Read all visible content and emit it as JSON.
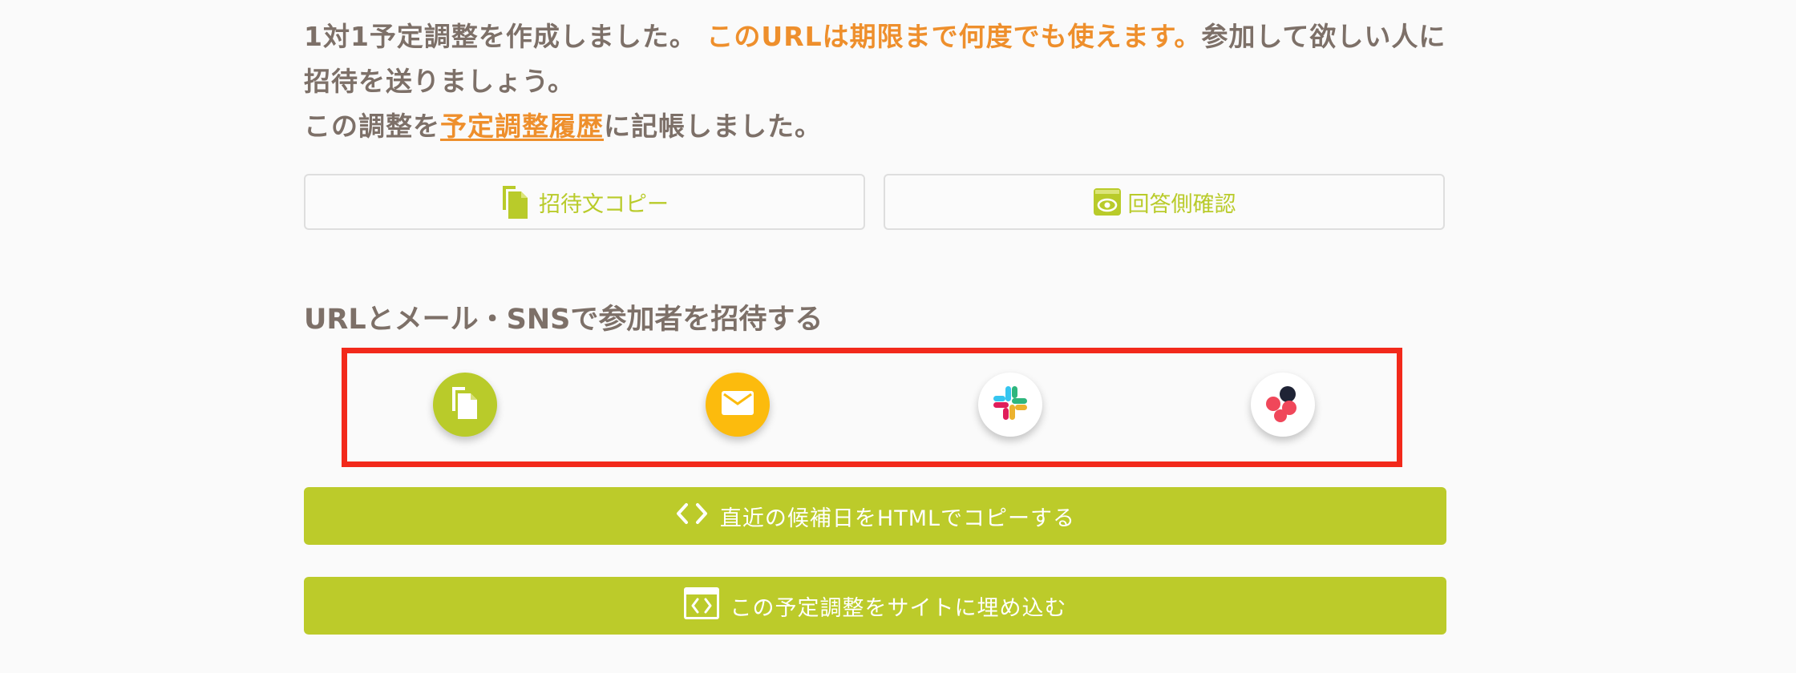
{
  "message": {
    "line1_start": "1対1予定調整を作成しました。 ",
    "line1_highlight": "このURLは期限まで何度でも使えます。",
    "line1_end": "参加して欲しい人に招待を送りましょう。",
    "line2_start": "この調整を",
    "history_link": "予定調整履歴",
    "line2_end": "に記帳しました。"
  },
  "buttons": {
    "copy_invite": {
      "label": "招待文コピー",
      "icon": "copy-document-icon"
    },
    "preview": {
      "label": "回答側確認",
      "icon": "eye-icon"
    }
  },
  "share": {
    "title": "URLとメール・SNSで参加者を招待する",
    "icons": [
      {
        "name": "copy-url",
        "icon": "copy-document-icon",
        "color": "#b9cb2a"
      },
      {
        "name": "email",
        "icon": "envelope-icon",
        "color": "#fcbb0d"
      },
      {
        "name": "slack",
        "icon": "slack-icon",
        "color": "#ffffff"
      },
      {
        "name": "asana",
        "icon": "asana-icon",
        "color": "#ffffff"
      }
    ]
  },
  "actions": {
    "copy_html": {
      "label": "直近の候補日をHTMLでコピーする",
      "icon": "code-brackets-icon"
    },
    "embed": {
      "label": "この予定調整をサイトに埋め込む",
      "icon": "embed-window-icon"
    }
  },
  "colors": {
    "accent_green": "#bccb2a",
    "accent_orange": "#ee8f2c",
    "text_brown": "#7d7068",
    "email_yellow": "#fcbb0d",
    "highlight_red": "#f2291b"
  }
}
